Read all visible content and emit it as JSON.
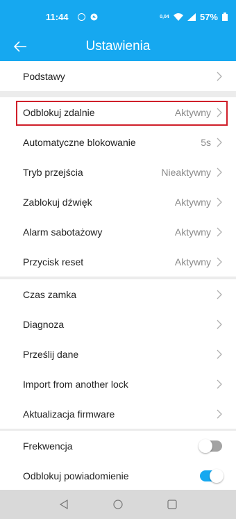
{
  "status": {
    "time": "11:44",
    "battery": "57%",
    "net_speed": "0,04"
  },
  "header": {
    "title": "Ustawienia"
  },
  "colors": {
    "accent": "#16a8f0",
    "highlight": "#d01f2a"
  },
  "group1": [
    {
      "label": "Podstawy",
      "value": ""
    }
  ],
  "group2": [
    {
      "label": "Odblokuj zdalnie",
      "value": "Aktywny"
    },
    {
      "label": "Automatyczne blokowanie",
      "value": "5s"
    },
    {
      "label": "Tryb przejścia",
      "value": "Nieaktywny"
    },
    {
      "label": "Zablokuj dźwięk",
      "value": "Aktywny"
    },
    {
      "label": "Alarm sabotażowy",
      "value": "Aktywny"
    },
    {
      "label": "Przycisk reset",
      "value": "Aktywny"
    }
  ],
  "group3": [
    {
      "label": "Czas zamka",
      "value": ""
    },
    {
      "label": "Diagnoza",
      "value": ""
    },
    {
      "label": "Prześlij dane",
      "value": ""
    },
    {
      "label": "Import from another lock",
      "value": ""
    },
    {
      "label": "Aktualizacja firmware",
      "value": ""
    }
  ],
  "group4": [
    {
      "label": "Frekwencja",
      "toggle": "off"
    },
    {
      "label": "Odblokuj powiadomienie",
      "toggle": "on"
    }
  ],
  "navbar": {
    "icons": [
      "back-triangle-icon",
      "home-circle-icon",
      "recents-square-icon"
    ]
  }
}
